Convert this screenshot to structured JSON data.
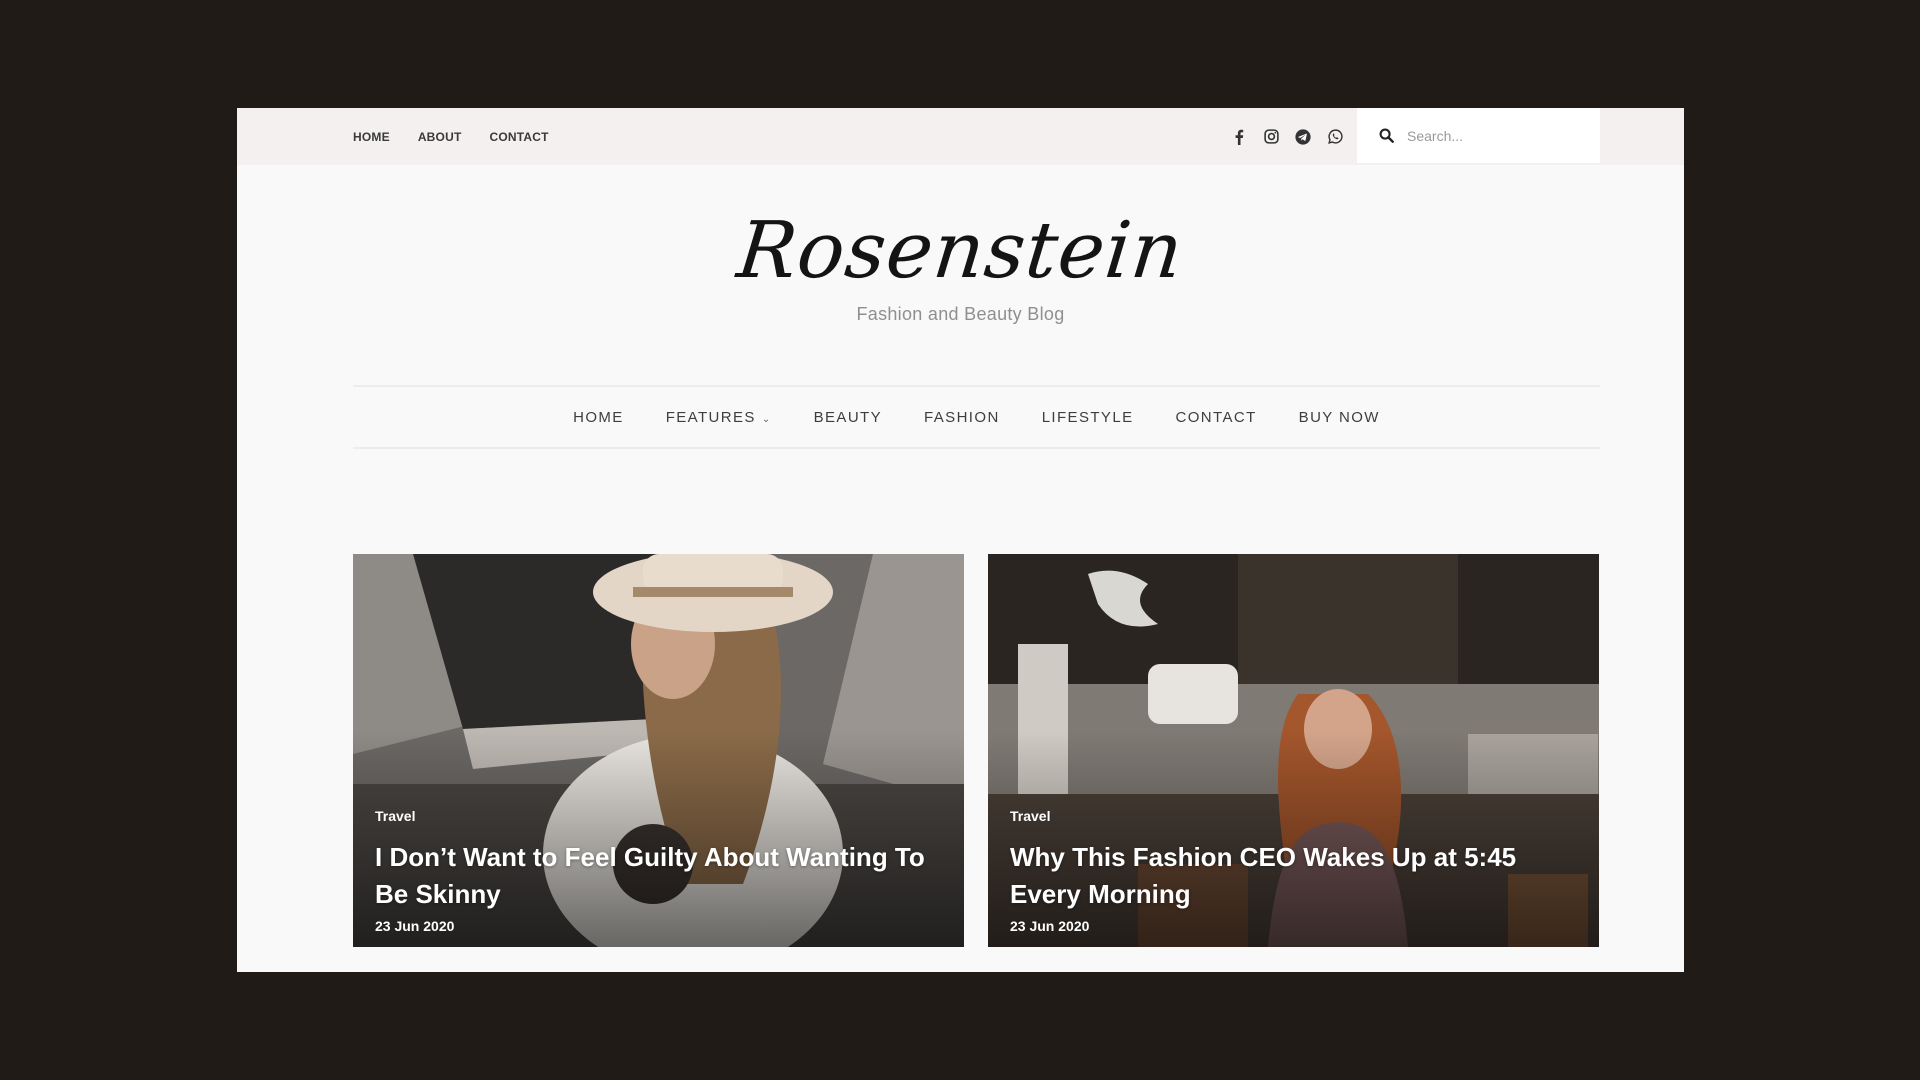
{
  "topbar": {
    "nav": [
      "HOME",
      "ABOUT",
      "CONTACT"
    ],
    "socials": [
      "facebook-icon",
      "instagram-icon",
      "telegram-icon",
      "whatsapp-icon"
    ],
    "search_placeholder": "Search..."
  },
  "brand": {
    "logo": "Rosenstein",
    "tagline": "Fashion and Beauty Blog"
  },
  "main_nav": {
    "home": "HOME",
    "features": "FEATURES",
    "beauty": "BEAUTY",
    "fashion": "FASHION",
    "lifestyle": "LIFESTYLE",
    "contact": "CONTACT",
    "buy_now": "BUY NOW"
  },
  "posts": [
    {
      "category": "Travel",
      "title": "I Don’t Want to Feel Guilty About Wanting To Be Skinny",
      "date": "23 Jun 2020"
    },
    {
      "category": "Travel",
      "title": "Why This Fashion CEO Wakes Up at 5:45 Every Morning",
      "date": "23 Jun 2020"
    }
  ],
  "colors": {
    "page_bg": "#201b17",
    "topbar_bg": "#f3f0ef",
    "site_bg": "#f9f9f9",
    "text_dark": "#3a3a3a"
  }
}
